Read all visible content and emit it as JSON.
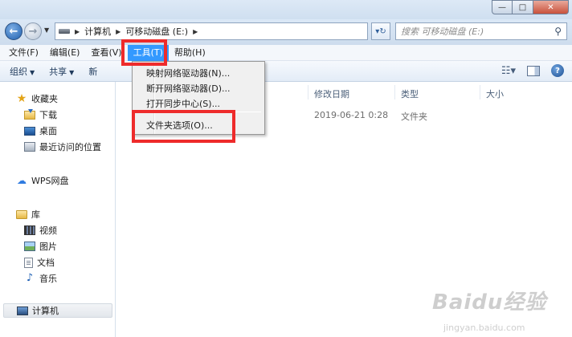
{
  "window": {
    "controls": [
      "—",
      "□",
      "✕"
    ]
  },
  "address": {
    "crumbs": [
      "计算机",
      "可移动磁盘 (E:)"
    ],
    "search_placeholder": "搜索 可移动磁盘 (E:)"
  },
  "menubar": {
    "items": [
      "文件(F)",
      "编辑(E)",
      "查看(V)",
      "工具(T)",
      "帮助(H)"
    ]
  },
  "toolbar": {
    "organize": "组织",
    "share": "共享",
    "new_truncated": "新"
  },
  "tools_menu": {
    "items": [
      "映射网络驱动器(N)...",
      "断开网络驱动器(D)...",
      "打开同步中心(S)...",
      "文件夹选项(O)..."
    ]
  },
  "sidebar": {
    "favorites": "收藏夹",
    "downloads": "下载",
    "desktop": "桌面",
    "recent": "最近访问的位置",
    "wps": "WPS网盘",
    "library": "库",
    "videos": "视频",
    "pictures": "图片",
    "documents": "文档",
    "music": "音乐",
    "computer": "计算机"
  },
  "columns": {
    "modified": "修改日期",
    "type": "类型",
    "size": "大小"
  },
  "rows": [
    {
      "modified": "2019-06-21 0:28",
      "type": "文件夹",
      "size": ""
    }
  ],
  "watermark": {
    "logo": "Baidu经验",
    "url": "jingyan.baidu.com"
  },
  "colors": {
    "highlight": "#ee2b2b",
    "menu_active": "#3399ff"
  }
}
